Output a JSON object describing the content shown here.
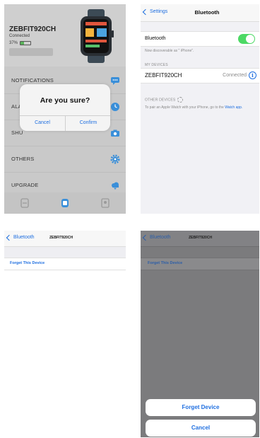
{
  "panel1": {
    "device_name": "ZEBFIT920CH",
    "device_status": "Connected",
    "battery_percent_label": "37%",
    "battery_level": 0.37,
    "battery_color": "#59b35a",
    "menu": [
      {
        "label": "NOTIFICATIONS",
        "icon": "chat-bubble-icon"
      },
      {
        "label": "ALA",
        "icon": "clock-icon"
      },
      {
        "label": "SHU",
        "icon": "camera-icon"
      },
      {
        "label": "OTHERS",
        "icon": "gear-icon"
      },
      {
        "label": "UPGRADE",
        "icon": "cloud-icon"
      }
    ],
    "tabbar": [
      "watch-face-icon",
      "watch-icon",
      "profile-icon"
    ],
    "dialog": {
      "title": "Are you sure?",
      "cancel": "Cancel",
      "confirm": "Confirm"
    },
    "accent": "#3a8fd9"
  },
  "panel2": {
    "back_label": "Settings",
    "title": "Bluetooth",
    "bluetooth_label": "Bluetooth",
    "bluetooth_on": true,
    "toggle_color": "#4cd964",
    "discoverable": "Now discoverable as \" iPhone\".",
    "my_devices_header": "MY DEVICES",
    "device_name": "ZEBFIT920CH",
    "device_status": "Connected",
    "other_devices_header": "OTHER DEVICES",
    "hint_text": "To pair an Apple Watch with your iPhone, go to the",
    "hint_link": "Watch app."
  },
  "panel3": {
    "back_label": "Bluetooth",
    "title": "ZEBFIT920CH",
    "forget_label": "Forget This Device"
  },
  "panel4": {
    "back_label": "Bluetooth",
    "title": "ZEBFIT920CH",
    "forget_label": "Forget This Device",
    "forget_device_button": "Forget Device",
    "cancel_button": "Cancel"
  },
  "link_color": "#1f6fe0"
}
